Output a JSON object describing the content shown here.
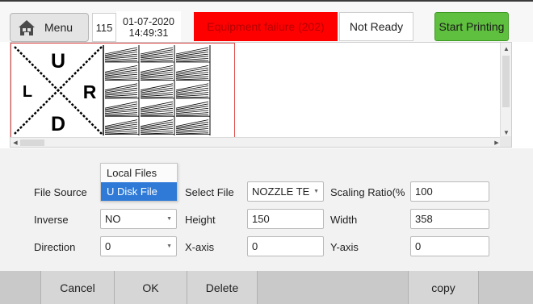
{
  "header": {
    "menu_label": "Menu",
    "counter": "115",
    "date": "01-07-2020",
    "time": "14:49:31",
    "alarm_text": "Equipment failure (202)",
    "status_text": "Not Ready",
    "start_label": "Start Printing",
    "colors": {
      "alarm": "#ff0000",
      "start": "#5fbf3e"
    }
  },
  "preview": {
    "letters": {
      "up": "U",
      "left": "L",
      "right": "R",
      "down": "D"
    }
  },
  "form": {
    "file_source_label": "File Source",
    "file_source_options": [
      "Local Files",
      "U Disk File"
    ],
    "file_source_selected": "U Disk File",
    "select_file_label": "Select File",
    "select_file_value": "NOZZLE TE",
    "scaling_label": "Scaling Ratio(%",
    "scaling_value": "100",
    "inverse_label": "Inverse",
    "inverse_value": "NO",
    "height_label": "Height",
    "height_value": "150",
    "width_label": "Width",
    "width_value": "358",
    "direction_label": "Direction",
    "direction_value": "0",
    "xaxis_label": "X-axis",
    "xaxis_value": "0",
    "yaxis_label": "Y-axis",
    "yaxis_value": "0"
  },
  "bottom": {
    "cancel": "Cancel",
    "ok": "OK",
    "delete": "Delete",
    "copy": "copy"
  }
}
